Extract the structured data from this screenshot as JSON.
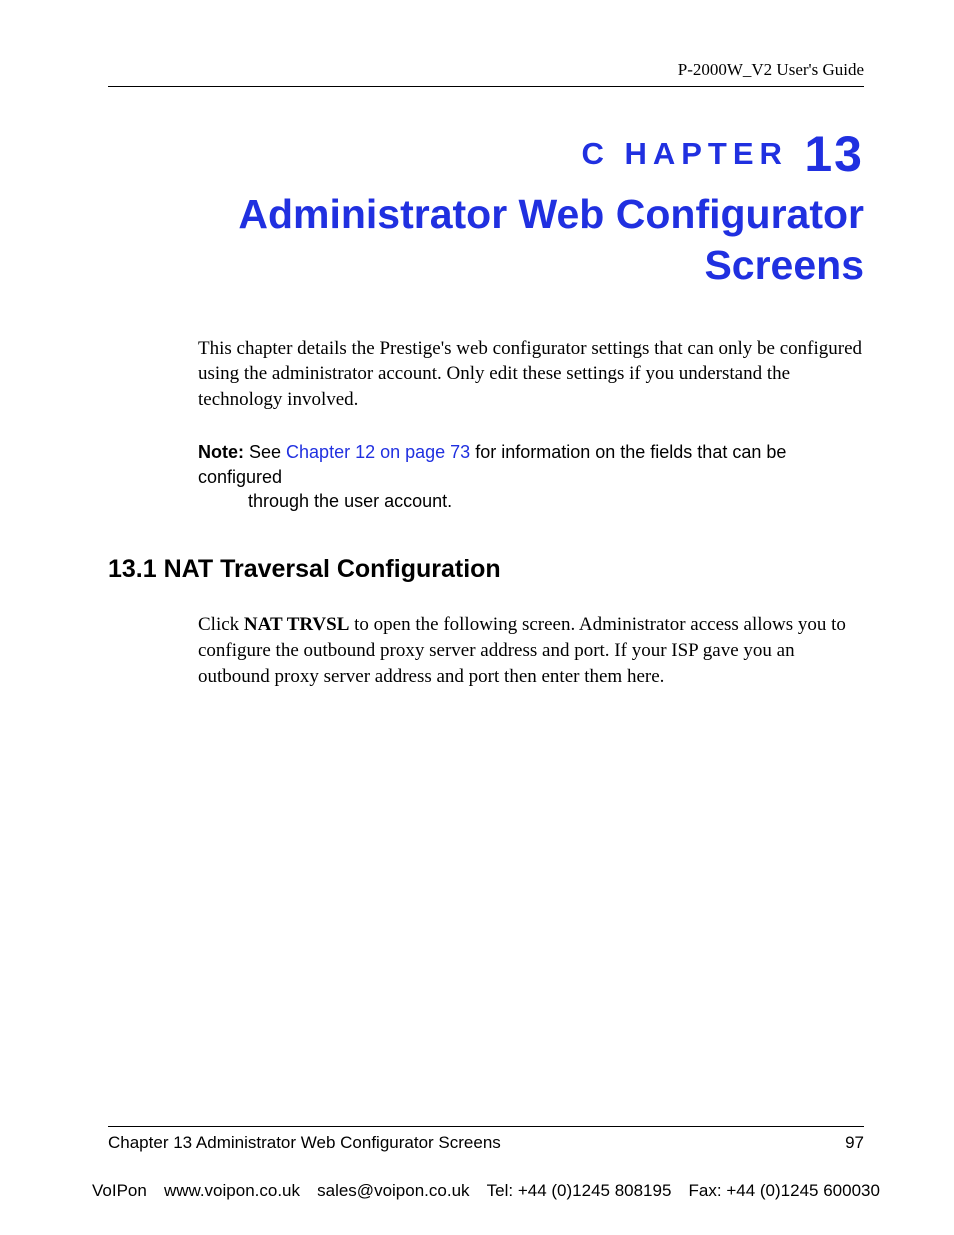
{
  "header": {
    "guide_name": "P-2000W_V2 User's Guide"
  },
  "chapter": {
    "label_small": "C HAPTER",
    "label_number": "13",
    "title": "Administrator Web Configurator Screens"
  },
  "intro": "This chapter details the Prestige's web configurator settings that can only be configured using the administrator account. Only edit these settings if you understand the technology involved.",
  "note": {
    "label": "Note:",
    "before_link": " See ",
    "link_text": "Chapter 12 on page 73",
    "after_link": " for information on the fields that can be configured",
    "line2": "through the user account."
  },
  "section": {
    "heading": "13.1  NAT Traversal Configuration",
    "body_before": "Click ",
    "body_bold": "NAT TRVSL",
    "body_after": " to open the following screen. Administrator access allows you to configure the outbound proxy server address and port. If your ISP gave you an outbound proxy server address and port then enter them here."
  },
  "footer": {
    "chapter_ref": "Chapter 13 Administrator Web Configurator Screens",
    "page_number": "97",
    "company": "VoIPon",
    "website": "www.voipon.co.uk",
    "email": "sales@voipon.co.uk",
    "tel": "Tel: +44 (0)1245 808195",
    "fax": "Fax: +44 (0)1245 600030"
  }
}
